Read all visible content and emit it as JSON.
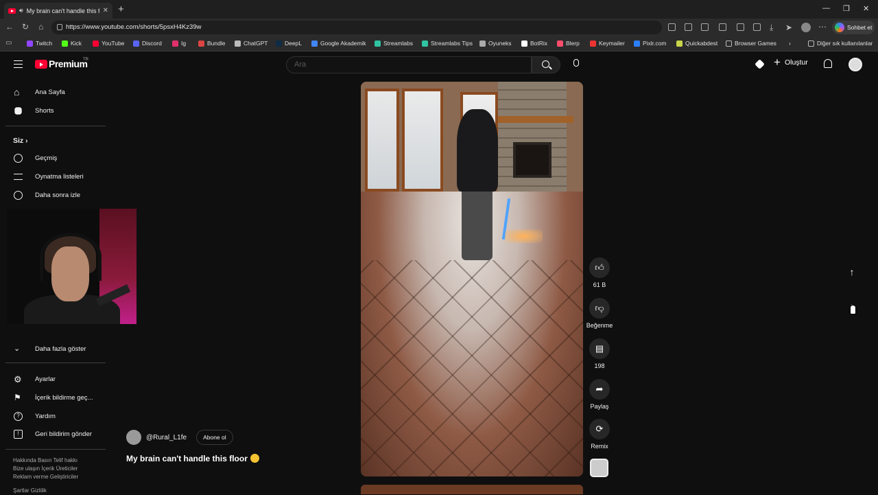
{
  "browser": {
    "tab_title": "My brain can't handle this floo",
    "url": "https://www.youtube.com/shorts/5psxH4Kz39w",
    "copilot_label": "Sohbet et",
    "bookmarks": [
      "Twitch",
      "Kick",
      "YouTube",
      "Discord",
      "Ig",
      "Bundle",
      "ChatGPT",
      "DeepL",
      "Google Akademik",
      "Streamlabs",
      "Streamlabs Tips",
      "Oyuneks",
      "BotRix",
      "Blerp",
      "Keymailer",
      "Pixlr.com",
      "Quickabdest",
      "Browser Games"
    ],
    "other_bookmarks": "Diğer sık kullanılanlar",
    "bookmark_colors": [
      "#9146ff",
      "#53fc18",
      "#ff0033",
      "#5865f2",
      "#e1306c",
      "#d44",
      "#bbb",
      "#0f2b46",
      "#4285f4",
      "#31c3a2",
      "#31c3a2",
      "#aaa",
      "#fff",
      "#ff4d6d",
      "#e33",
      "#2d7ff9",
      "#c8d44a",
      "#bbb"
    ]
  },
  "header": {
    "logo": "Premium",
    "region": "TR",
    "search_placeholder": "Ara",
    "create_label": "Oluştur"
  },
  "sidebar": {
    "main": [
      {
        "label": "Ana Sayfa",
        "icon": "home-icon"
      },
      {
        "label": "Shorts",
        "icon": "shorts-icon"
      }
    ],
    "section_title": "Siz",
    "you": [
      {
        "label": "Geçmiş",
        "icon": "history-icon"
      },
      {
        "label": "Oynatma listeleri",
        "icon": "playlist-icon"
      },
      {
        "label": "Daha sonra izle",
        "icon": "clock-icon"
      }
    ],
    "show_more": "Daha fazla göster",
    "settings": [
      {
        "label": "Ayarlar",
        "icon": "gear-icon"
      },
      {
        "label": "İçerik bildirme geç...",
        "icon": "flag-icon"
      },
      {
        "label": "Yardım",
        "icon": "help-icon"
      },
      {
        "label": "Geri bildirim gönder",
        "icon": "feedback-icon"
      }
    ],
    "footer1": "Hakkında   Basın   Telif hakkı",
    "footer2": "Bize ulaşın   İçerik Üreticiler",
    "footer3": "Reklam verme   Geliştiriciler",
    "footer4": "Şartlar   Gizlilik"
  },
  "short": {
    "channel": "@Rural_L1fe",
    "subscribe": "Abone ol",
    "title": "My brain can't handle this floor",
    "likes": "61 B",
    "dislike_label": "Beğenme",
    "comments": "198",
    "share_label": "Paylaş",
    "remix_label": "Remix"
  }
}
